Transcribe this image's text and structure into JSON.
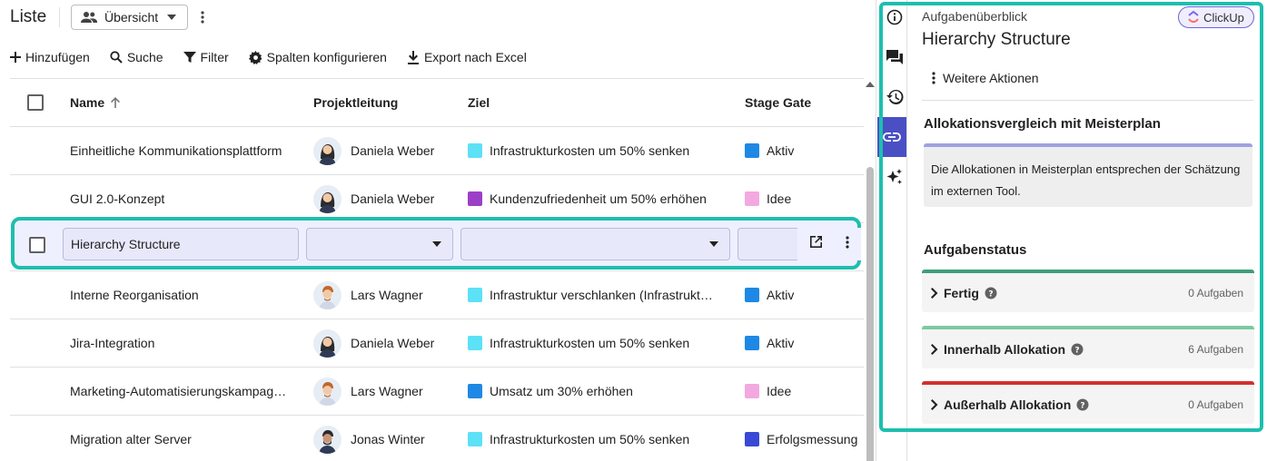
{
  "header": {
    "title": "Liste",
    "view_select": "Übersicht"
  },
  "toolbar": {
    "add": "Hinzufügen",
    "search": "Suche",
    "filter": "Filter",
    "columns": "Spalten konfigurieren",
    "export": "Export nach Excel"
  },
  "table": {
    "columns": {
      "name": "Name",
      "lead": "Projektleitung",
      "goal": "Ziel",
      "stage": "Stage Gate"
    },
    "rows": [
      {
        "name": "Einheitliche Kommunikationsplattform",
        "lead": "Daniela Weber",
        "goal": "Infrastrukturkosten um 50% senken",
        "goal_color": "#5ce1f6",
        "stage": "Aktiv",
        "stage_color": "#1e88e5"
      },
      {
        "name": "GUI 2.0-Konzept",
        "lead": "Daniela Weber",
        "goal": "Kundenzufriedenheit um 50% erhöhen",
        "goal_color": "#9c3fc7",
        "stage": "Idee",
        "stage_color": "#f3a9e0"
      },
      {
        "name": "Interne Reorganisation",
        "lead": "Lars Wagner",
        "goal": "Infrastruktur verschlanken (Infrastrukt…",
        "goal_color": "#5ce1f6",
        "stage": "Aktiv",
        "stage_color": "#1e88e5"
      },
      {
        "name": "Jira-Integration",
        "lead": "Daniela Weber",
        "goal": "Infrastrukturkosten um 50% senken",
        "goal_color": "#5ce1f6",
        "stage": "Aktiv",
        "stage_color": "#1e88e5"
      },
      {
        "name": "Marketing-Automatisierungskampag…",
        "lead": "Lars Wagner",
        "goal": "Umsatz um 30% erhöhen",
        "goal_color": "#1e88e5",
        "stage": "Idee",
        "stage_color": "#f3a9e0"
      },
      {
        "name": "Migration alter Server",
        "lead": "Jonas Winter",
        "goal": "Infrastrukturkosten um 50% senken",
        "goal_color": "#5ce1f6",
        "stage": "Erfolgsmessung",
        "stage_color": "#3949d6"
      }
    ],
    "editing_row": {
      "name": "Hierarchy Structure"
    }
  },
  "panel": {
    "overline": "Aufgabenüberblick",
    "clickup_label": "ClickUp",
    "title": "Hierarchy Structure",
    "more_actions": "Weitere Aktionen",
    "allocation_title": "Allokationsvergleich mit Meisterplan",
    "allocation_text": "Die Allokationen in Meisterplan entsprechen der Schätzung im externen Tool.",
    "status_title": "Aufgabenstatus",
    "statuses": [
      {
        "label": "Fertig",
        "count": "0 Aufgaben",
        "color": "#3f9e7a"
      },
      {
        "label": "Innerhalb Allokation",
        "count": "6 Aufgaben",
        "color": "#7cc9a3"
      },
      {
        "label": "Außerhalb Allokation",
        "count": "0 Aufgaben",
        "color": "#d32f2f"
      }
    ]
  },
  "icons": {
    "rail": [
      "info-icon",
      "comments-icon",
      "history-icon",
      "link-icon",
      "sparkle-icon"
    ]
  }
}
